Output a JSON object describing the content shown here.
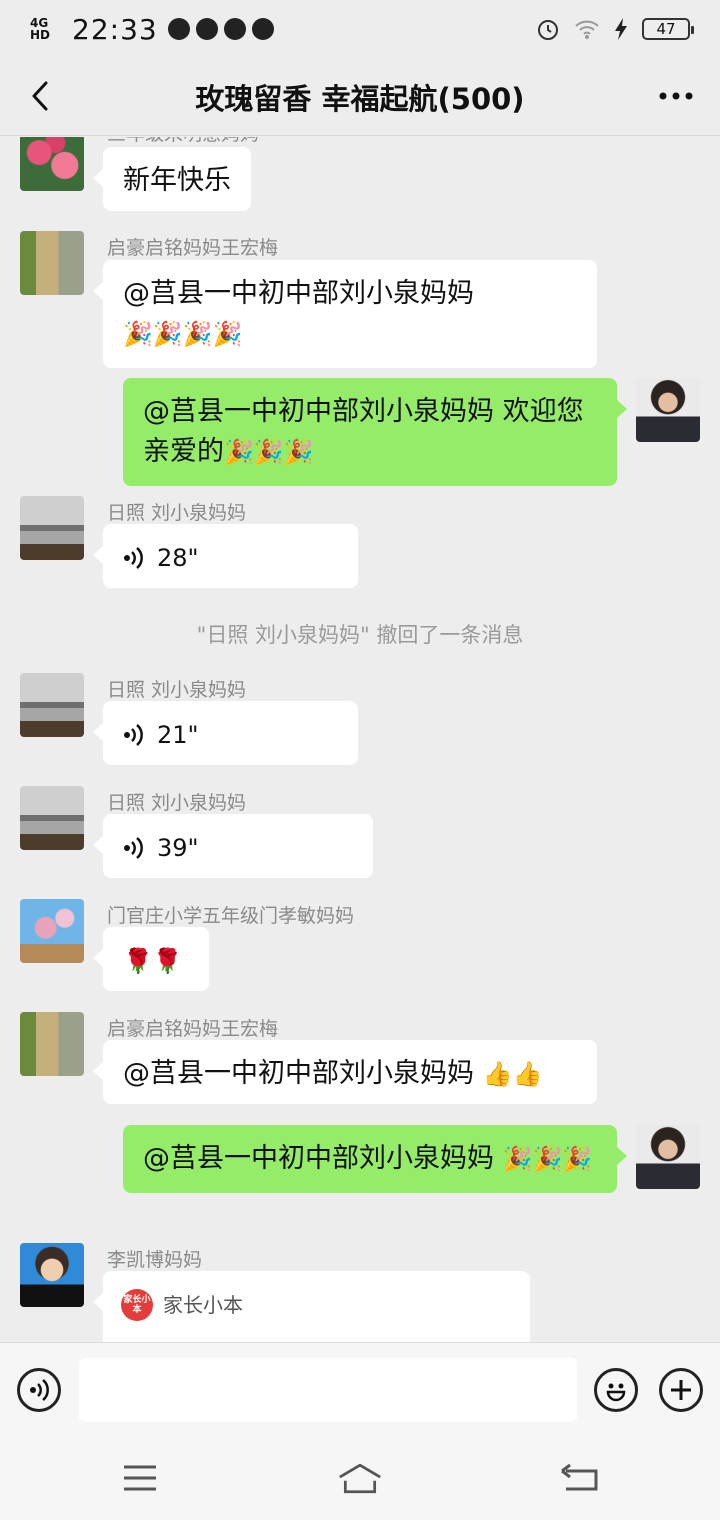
{
  "status_bar": {
    "network": "4G HD",
    "time": "22:33",
    "battery": "47"
  },
  "header": {
    "title": "玫瑰留香  幸福起航(500)",
    "more_label": "···"
  },
  "messages": [
    {
      "type": "text",
      "side": "left",
      "sender": "三年级宋明慧妈妈",
      "text": "新年快乐",
      "avatar": "flowers"
    },
    {
      "type": "text",
      "side": "left",
      "sender": "启豪启铭妈妈王宏梅",
      "text": "@莒县一中初中部刘小泉妈妈 ",
      "emojis": "🎉🎉🎉🎉",
      "avatar": "road"
    },
    {
      "type": "text",
      "side": "right",
      "text": "@莒县一中初中部刘小泉妈妈  欢迎您亲爱的",
      "emojis": "🎉🎉🎉",
      "avatar": "woman"
    },
    {
      "type": "voice",
      "side": "left",
      "sender": "日照  刘小泉妈妈",
      "duration": "28\"",
      "avatar": "lake"
    },
    {
      "type": "system",
      "text": "\"日照  刘小泉妈妈\" 撤回了一条消息"
    },
    {
      "type": "voice",
      "side": "left",
      "sender": "日照  刘小泉妈妈",
      "duration": "21\"",
      "avatar": "lake"
    },
    {
      "type": "voice",
      "side": "left",
      "sender": "日照  刘小泉妈妈",
      "duration": "39\"",
      "avatar": "lake"
    },
    {
      "type": "emoji",
      "side": "left",
      "sender": "门官庄小学五年级门孝敏妈妈",
      "emojis": "🌹🌹",
      "avatar": "magnolia"
    },
    {
      "type": "text",
      "side": "left",
      "sender": "启豪启铭妈妈王宏梅",
      "text": "@莒县一中初中部刘小泉妈妈 ",
      "emojis": "👍👍",
      "avatar": "road"
    },
    {
      "type": "text",
      "side": "right",
      "text": "@莒县一中初中部刘小泉妈妈 ",
      "emojis": "🎉🎉🎉",
      "avatar": "woman"
    },
    {
      "type": "card",
      "side": "left",
      "sender": "李凯博妈妈",
      "card_logo": "家长小本",
      "card_title": "家长小本",
      "avatar": "lady"
    }
  ],
  "input_bar": {
    "placeholder": ""
  }
}
